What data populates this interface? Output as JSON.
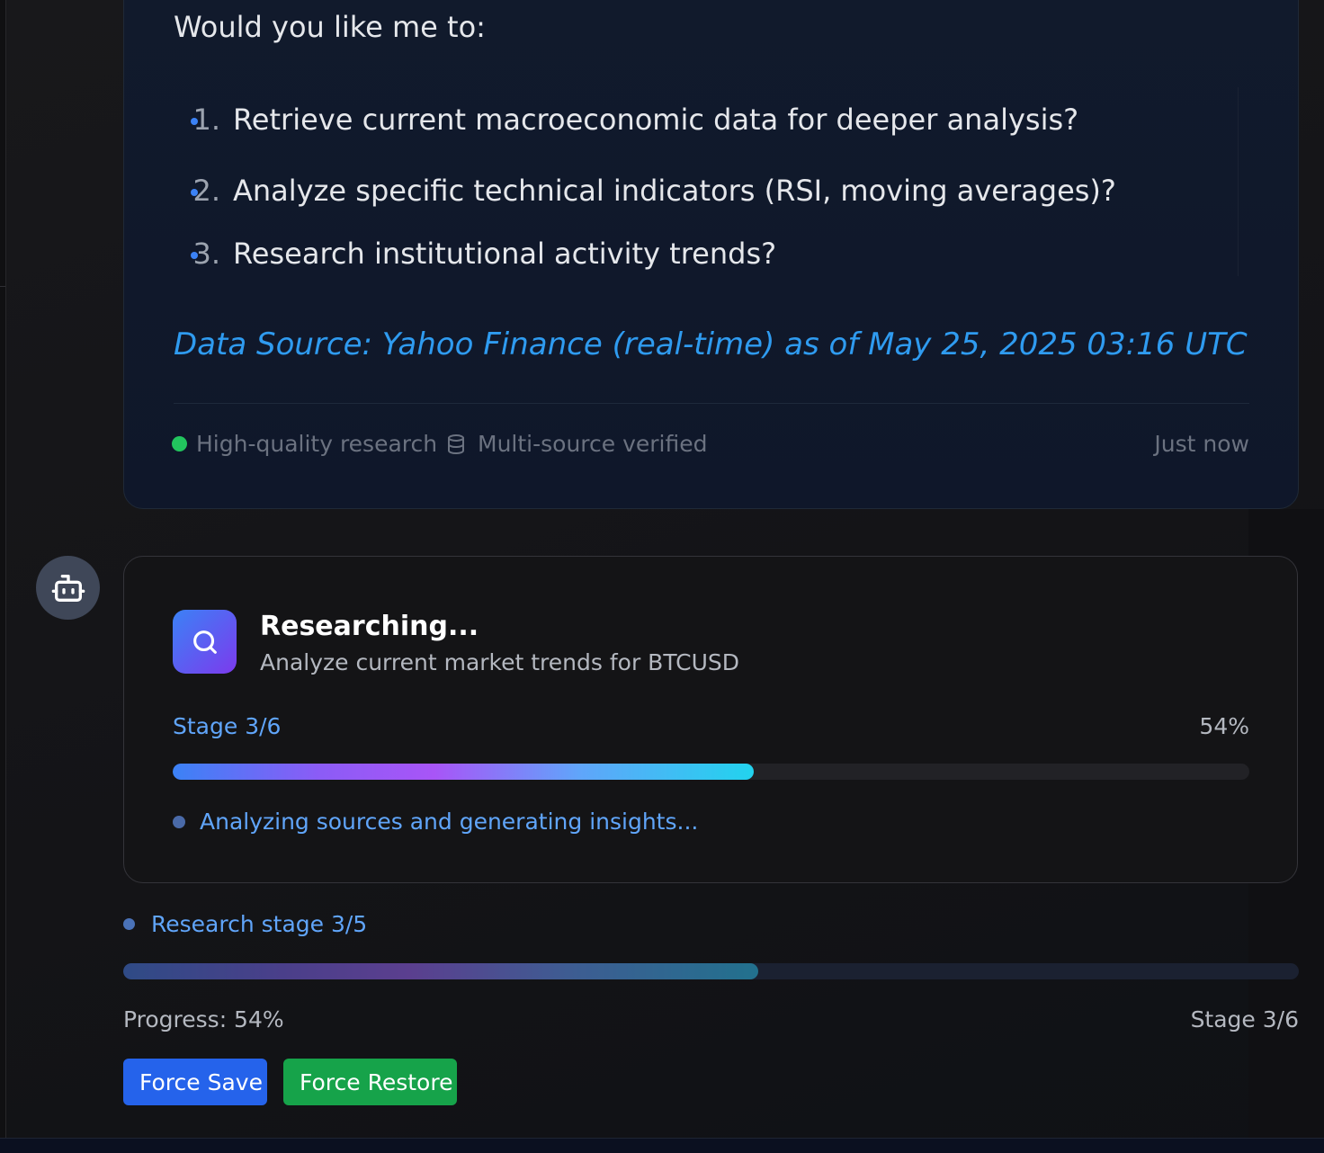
{
  "message": {
    "intro": "Would you like me to:",
    "options": [
      {
        "num": "1.",
        "text": "Retrieve current macroeconomic data for deeper analysis?"
      },
      {
        "num": "2.",
        "text": "Analyze specific technical indicators (RSI, moving averages)?"
      },
      {
        "num": "3.",
        "text": "Research institutional activity trends?"
      }
    ],
    "data_source": "Data Source: Yahoo Finance (real-time) as of May 25, 2025 03:16 UTC",
    "footer": {
      "quality": "High-quality research",
      "verified": "Multi-source verified",
      "timestamp": "Just now"
    }
  },
  "research": {
    "title": "Researching...",
    "query": "Analyze current market trends for BTCUSD",
    "stage": "Stage 3/6",
    "percent_label": "54%",
    "progress": 0.54,
    "status": "Analyzing sources and generating insights..."
  },
  "status_panel": {
    "stage_text": "Research stage 3/5",
    "progress": 0.54,
    "progress_label": "Progress: 54%",
    "stage_right": "Stage 3/6"
  },
  "buttons": {
    "force_save": "Force Save",
    "force_restore": "Force Restore"
  },
  "icons": {
    "avatar": "bot-icon",
    "research": "search-icon",
    "verified": "database-icon"
  },
  "colors": {
    "link_blue": "#2f9bf0",
    "accent_blue": "#60a5fa",
    "quality_green": "#22c55e",
    "save_button": "#2563eb",
    "restore_button": "#16a34a"
  }
}
